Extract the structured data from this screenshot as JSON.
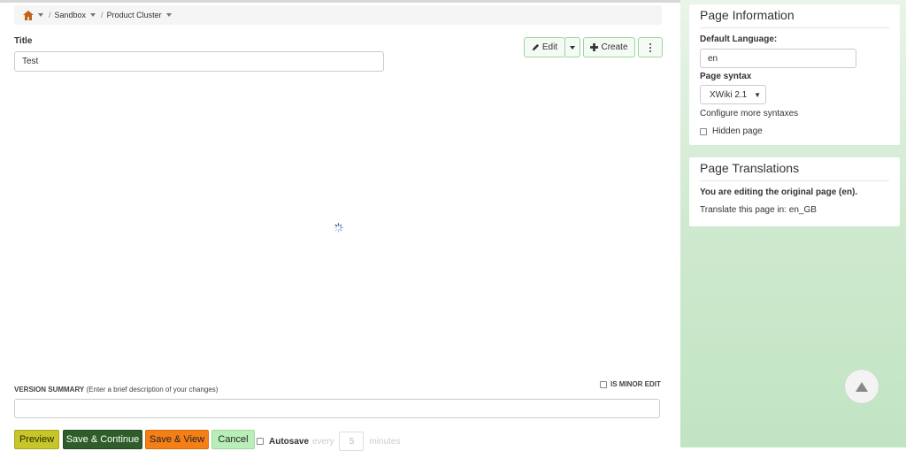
{
  "breadcrumb": {
    "items": [
      {
        "label": "Sandbox"
      },
      {
        "label": "Product Cluster"
      }
    ],
    "separator": "/"
  },
  "title": {
    "label": "Title",
    "value": "Test"
  },
  "actions": {
    "edit": "Edit",
    "create": "Create"
  },
  "version_summary": {
    "label": "VERSION SUMMARY",
    "hint": "(Enter a brief description of your changes)",
    "value": ""
  },
  "minor_edit": {
    "label": "IS MINOR EDIT"
  },
  "buttons": {
    "preview": "Preview",
    "save_continue": "Save & Continue",
    "save_view": "Save & View",
    "cancel": "Cancel"
  },
  "autosave": {
    "label": "Autosave",
    "every": "every",
    "minutes_value": "5",
    "minutes_label": "minutes"
  },
  "page_information": {
    "title": "Page Information",
    "default_language_label": "Default Language:",
    "default_language_value": "en",
    "page_syntax_label": "Page syntax",
    "page_syntax_value": "XWiki 2.1",
    "configure_link": "Configure more syntaxes",
    "hidden_page_label": "Hidden page"
  },
  "page_translations": {
    "title": "Page Translations",
    "editing_text": "You are editing the original page (en).",
    "translate_text": "Translate this page in: en_GB"
  },
  "colors": {
    "preview": "#c6c62a",
    "save_continue": "#2e5d2a",
    "save_view": "#f57f17",
    "cancel": "#b9eeb9",
    "sidebar_bg": "#cfe9cf"
  }
}
